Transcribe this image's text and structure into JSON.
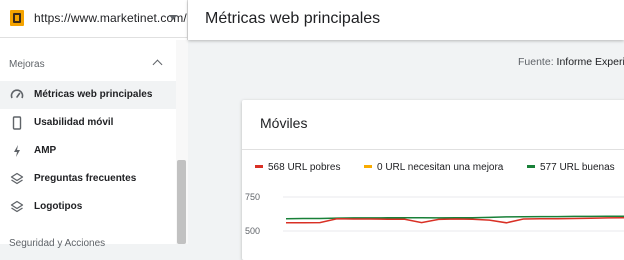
{
  "sidebar": {
    "property_url": "https://www.marketinet.com/",
    "group_label": "Mejoras",
    "items": [
      {
        "label": "Métricas web principales",
        "icon": "gauge-icon",
        "active": true
      },
      {
        "label": "Usabilidad móvil",
        "icon": "smartphone-icon",
        "active": false
      },
      {
        "label": "AMP",
        "icon": "lightning-icon",
        "active": false
      },
      {
        "label": "Preguntas frecuentes",
        "icon": "layers-icon",
        "active": false
      },
      {
        "label": "Logotipos",
        "icon": "layers-icon",
        "active": false
      }
    ],
    "next_group_label": "Seguridad y Acciones"
  },
  "header": {
    "title": "Métricas web principales"
  },
  "source": {
    "label": "Fuente:",
    "value": "Informe Experi"
  },
  "card": {
    "title": "Móviles"
  },
  "chart_data": {
    "type": "line",
    "legend": [
      {
        "label": "568 URL pobres",
        "color": "#d93025"
      },
      {
        "label": "0 URL necesitan una mejora",
        "color": "#f9ab00"
      },
      {
        "label": "577 URL buenas",
        "color": "#188038"
      }
    ],
    "y_ticks": [
      "750",
      "500"
    ],
    "grid": true,
    "series": [
      {
        "name": "568 URL pobres",
        "color": "#d93025",
        "values": [
          560,
          560,
          562,
          590,
          588,
          588,
          587,
          586,
          562,
          585,
          588,
          587,
          580,
          560,
          588,
          590,
          590,
          592,
          594,
          596,
          598,
          598
        ]
      },
      {
        "name": "577 URL buenas",
        "color": "#188038",
        "values": [
          590,
          592,
          592,
          595,
          596,
          596,
          597,
          597,
          597,
          596,
          597,
          598,
          600,
          604,
          605,
          606,
          606,
          607,
          607,
          608,
          608,
          608
        ]
      }
    ]
  }
}
